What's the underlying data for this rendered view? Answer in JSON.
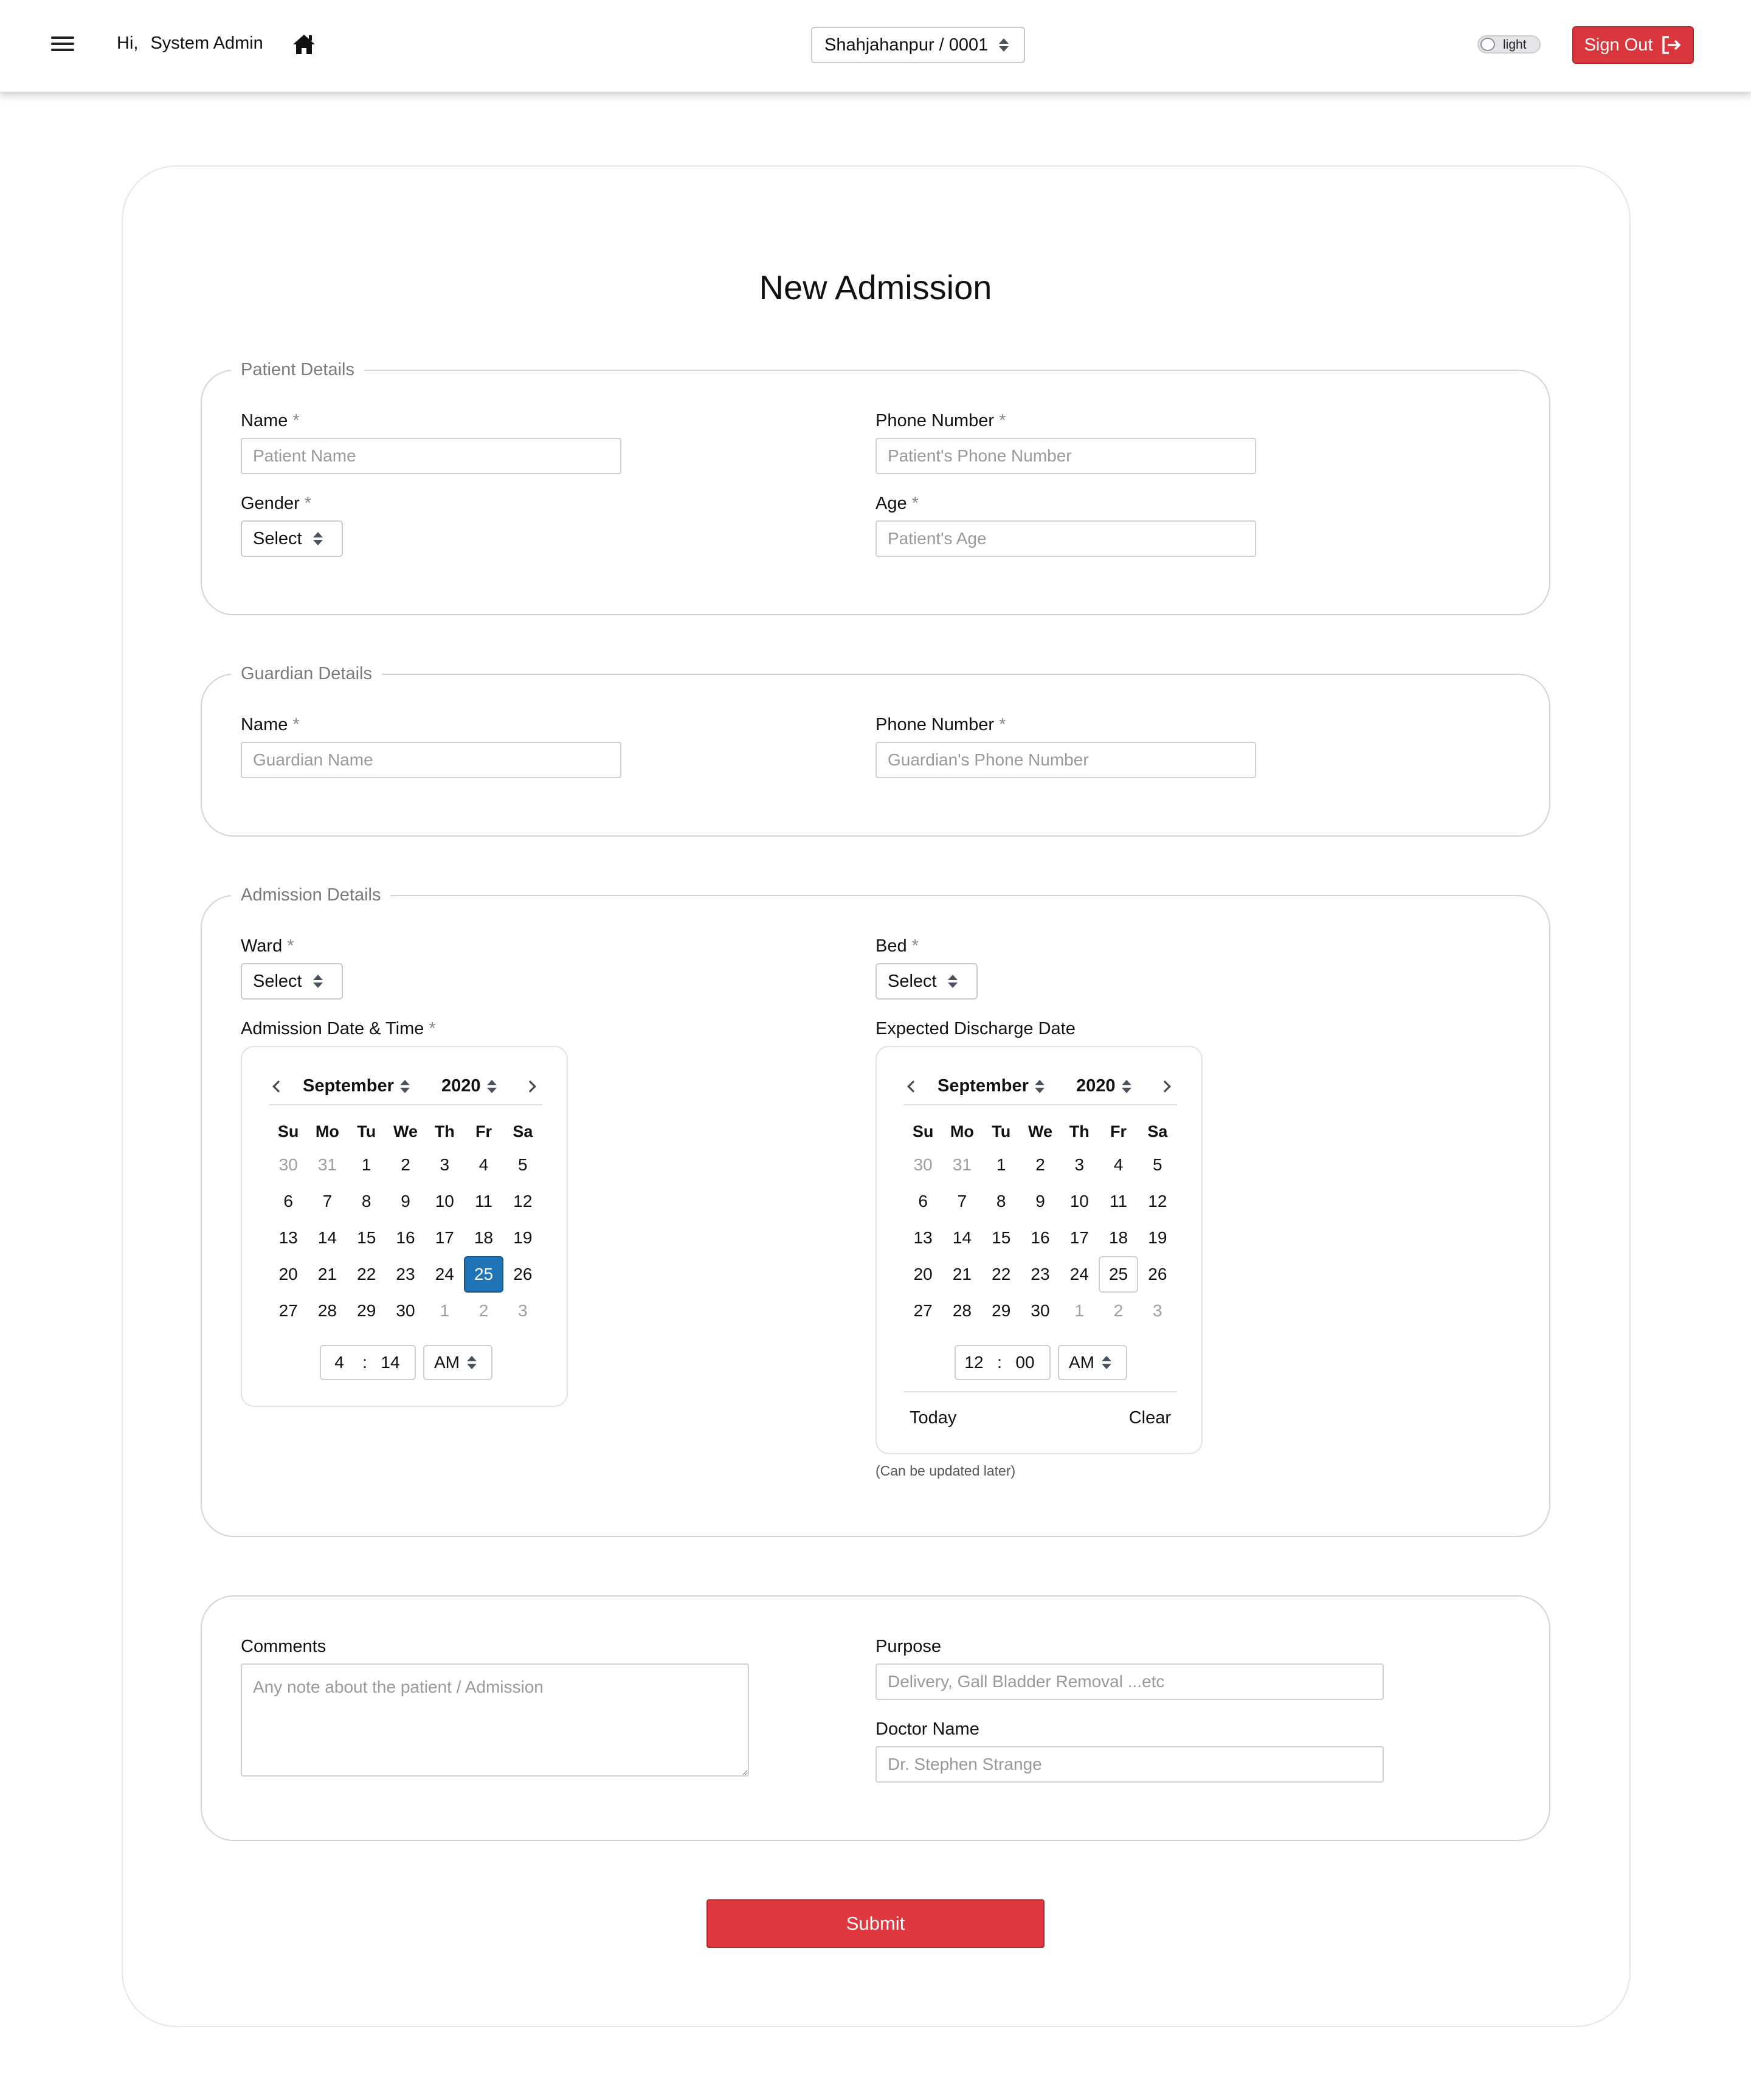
{
  "navbar": {
    "greeting_prefix": "Hi,",
    "user_name": "System Admin",
    "location_selected": "Shahjahanpur / 0001",
    "theme_label": "light",
    "signout_label": "Sign Out"
  },
  "page": {
    "title": "New Admission"
  },
  "patient": {
    "legend": "Patient Details",
    "name_label": "Name",
    "name_placeholder": "Patient Name",
    "phone_label": "Phone Number",
    "phone_placeholder": "Patient's Phone Number",
    "gender_label": "Gender",
    "gender_selected": "Select",
    "age_label": "Age",
    "age_placeholder": "Patient's Age"
  },
  "guardian": {
    "legend": "Guardian Details",
    "name_label": "Name",
    "name_placeholder": "Guardian Name",
    "phone_label": "Phone Number",
    "phone_placeholder": "Guardian's Phone Number"
  },
  "admission": {
    "legend": "Admission Details",
    "ward_label": "Ward",
    "ward_selected": "Select",
    "bed_label": "Bed",
    "bed_selected": "Select",
    "admission_dt_label": "Admission Date & Time",
    "discharge_label": "Expected Discharge Date",
    "discharge_hint": "(Can be updated later)"
  },
  "calendar": {
    "weekdays": [
      "Su",
      "Mo",
      "Tu",
      "We",
      "Th",
      "Fr",
      "Sa"
    ],
    "weeks": [
      [
        {
          "d": "30",
          "m": true
        },
        {
          "d": "31",
          "m": true
        },
        {
          "d": "1"
        },
        {
          "d": "2"
        },
        {
          "d": "3"
        },
        {
          "d": "4"
        },
        {
          "d": "5"
        }
      ],
      [
        {
          "d": "6"
        },
        {
          "d": "7"
        },
        {
          "d": "8"
        },
        {
          "d": "9"
        },
        {
          "d": "10"
        },
        {
          "d": "11"
        },
        {
          "d": "12"
        }
      ],
      [
        {
          "d": "13"
        },
        {
          "d": "14"
        },
        {
          "d": "15"
        },
        {
          "d": "16"
        },
        {
          "d": "17"
        },
        {
          "d": "18"
        },
        {
          "d": "19"
        }
      ],
      [
        {
          "d": "20"
        },
        {
          "d": "21"
        },
        {
          "d": "22"
        },
        {
          "d": "23"
        },
        {
          "d": "24"
        },
        {
          "d": "25"
        },
        {
          "d": "26"
        }
      ],
      [
        {
          "d": "27"
        },
        {
          "d": "28"
        },
        {
          "d": "29"
        },
        {
          "d": "30"
        },
        {
          "d": "1",
          "m": true
        },
        {
          "d": "2",
          "m": true
        },
        {
          "d": "3",
          "m": true
        }
      ]
    ],
    "admission": {
      "month": "September",
      "year": "2020",
      "selected_day": "25",
      "hour": "4",
      "minute": "14",
      "ampm": "AM"
    },
    "discharge": {
      "month": "September",
      "year": "2020",
      "today_day": "25",
      "hour": "12",
      "minute": "00",
      "ampm": "AM",
      "today_label": "Today",
      "clear_label": "Clear"
    }
  },
  "extra": {
    "comments_label": "Comments",
    "comments_placeholder": "Any note about the patient / Admission",
    "purpose_label": "Purpose",
    "purpose_placeholder": "Delivery, Gall Bladder Removal ...etc",
    "doctor_label": "Doctor Name",
    "doctor_placeholder": "Dr. Stephen Strange"
  },
  "form": {
    "required_mark": "*",
    "submit_label": "Submit"
  },
  "colors": {
    "primary_red": "#e0383f",
    "selected_blue": "#1f73b7"
  }
}
